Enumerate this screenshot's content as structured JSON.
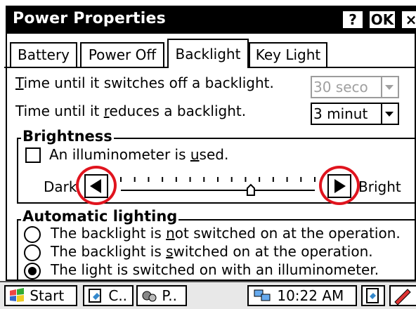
{
  "window": {
    "title": "Power Properties",
    "help_label": "?",
    "ok_label": "OK",
    "close_label": "×"
  },
  "tabs": [
    {
      "label": "Battery"
    },
    {
      "label": "Power Off"
    },
    {
      "label": "Backlight",
      "active": true
    },
    {
      "label": "Key Light"
    }
  ],
  "backlight": {
    "switch_off_prefix": "",
    "switch_off_ul": "T",
    "switch_off_rest": "ime until it switches off a backlight.",
    "switch_off_value": "30 seco",
    "reduce_prefix": "Time until it ",
    "reduce_ul": "r",
    "reduce_rest": "educes a backlight.",
    "reduce_value": "3 minut"
  },
  "brightness": {
    "title": "Brightness",
    "illuminometer_prefix": "An illuminometer is ",
    "illuminometer_ul": "u",
    "illuminometer_rest": "sed.",
    "illuminometer_checked": false,
    "dark_label": "Dark",
    "bright_label": "Bright",
    "level_fraction": 0.67
  },
  "automatic_lighting": {
    "title": "Automatic lighting",
    "options": [
      {
        "pre": "The backlight is ",
        "ul": "n",
        "post": "ot switched on at the operation.",
        "selected": false
      },
      {
        "pre": "The backlight is ",
        "ul": "s",
        "post": "witched on at the operation.",
        "selected": false
      },
      {
        "pre": "The light is switched on with an illuminometer.",
        "ul": "",
        "post": "",
        "selected": true
      }
    ]
  },
  "taskbar": {
    "start_label": "Start",
    "task1_label": "C..",
    "task2_label": "P..",
    "clock": "10:22 AM"
  },
  "colors": {
    "highlight_circle": "#e0141e",
    "titlebar": "#000000"
  }
}
